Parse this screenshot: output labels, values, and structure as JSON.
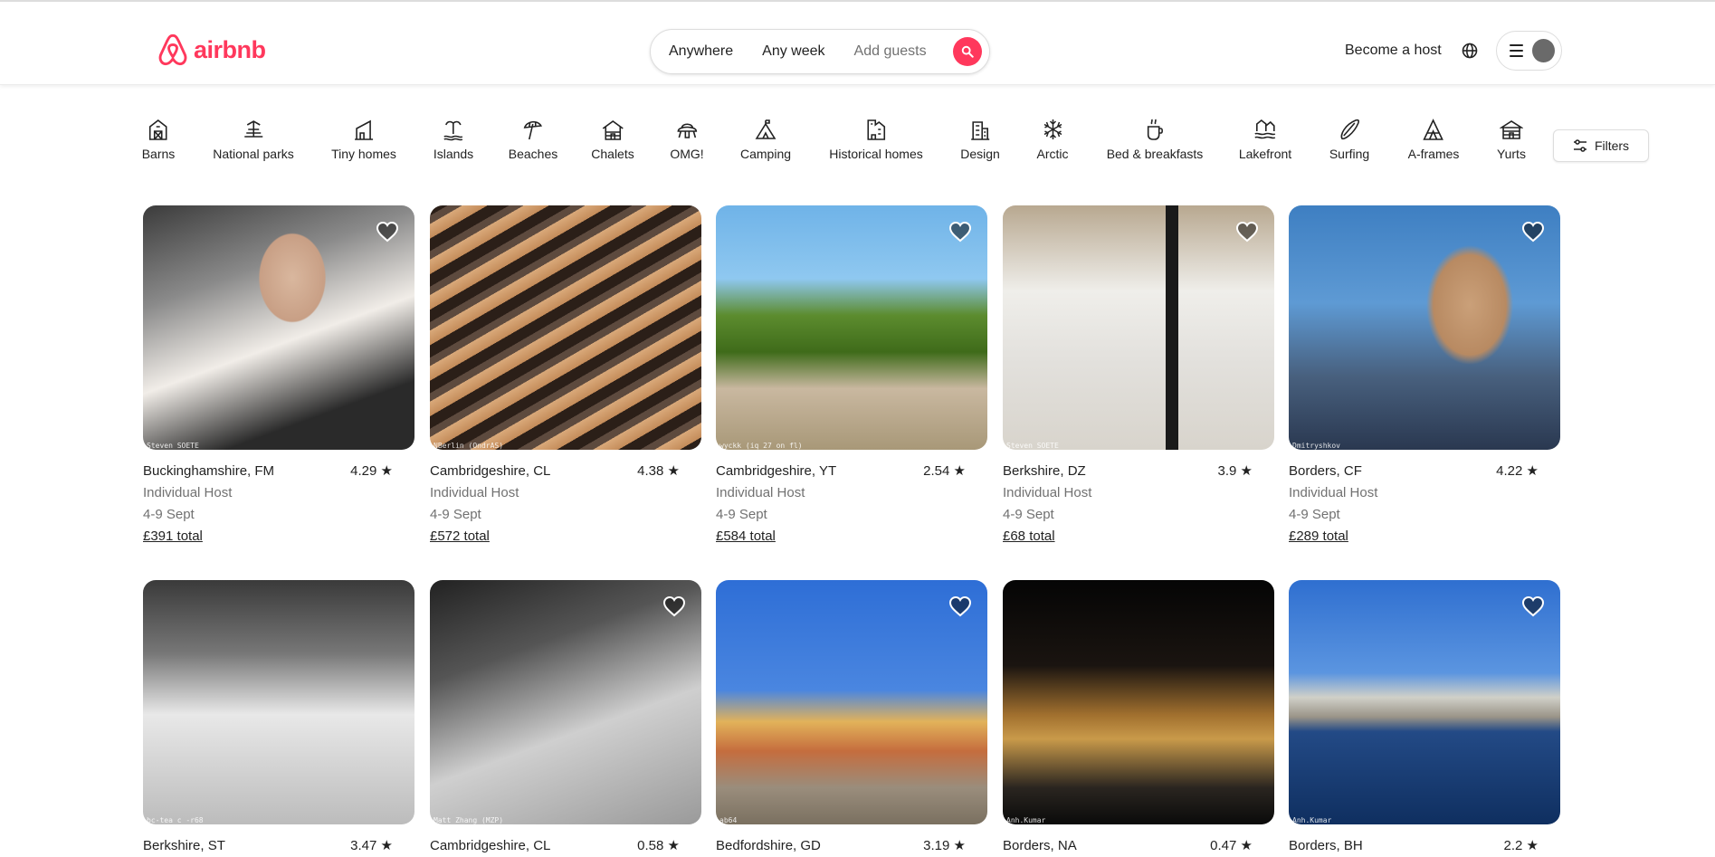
{
  "header": {
    "logo_text": "airbnb",
    "brand_color": "#ff385c",
    "search": {
      "anywhere": "Anywhere",
      "any_week": "Any week",
      "add_guests": "Add guests"
    },
    "become_host": "Become a host"
  },
  "categories": [
    {
      "label": "Barns",
      "icon": "barn-icon"
    },
    {
      "label": "National parks",
      "icon": "national-park-icon"
    },
    {
      "label": "Tiny homes",
      "icon": "tiny-home-icon"
    },
    {
      "label": "Islands",
      "icon": "island-icon"
    },
    {
      "label": "Beaches",
      "icon": "beach-umbrella-icon"
    },
    {
      "label": "Chalets",
      "icon": "chalet-icon"
    },
    {
      "label": "OMG!",
      "icon": "ufo-house-icon"
    },
    {
      "label": "Camping",
      "icon": "camping-icon"
    },
    {
      "label": "Historical homes",
      "icon": "historical-home-icon"
    },
    {
      "label": "Design",
      "icon": "design-building-icon"
    },
    {
      "label": "Arctic",
      "icon": "snowflake-icon"
    },
    {
      "label": "Bed & breakfasts",
      "icon": "coffee-cup-icon"
    },
    {
      "label": "Lakefront",
      "icon": "lakefront-icon"
    },
    {
      "label": "Surfing",
      "icon": "surfboard-icon"
    },
    {
      "label": "A-frames",
      "icon": "a-frame-icon"
    },
    {
      "label": "Yurts",
      "icon": "yurt-icon"
    }
  ],
  "filters_label": "Filters",
  "listings": [
    {
      "location": "Buckinghamshire, FM",
      "rating": "4.29",
      "host": "Individual Host",
      "dates": "4-9 Sept",
      "price": "£391 total",
      "credit": "Steven SOETE"
    },
    {
      "location": "Cambridgeshire, CL",
      "rating": "4.38",
      "host": "Individual Host",
      "dates": "4-9 Sept",
      "price": "£572 total",
      "credit": "NBerlin (OndrAS)"
    },
    {
      "location": "Cambridgeshire, YT",
      "rating": "2.54",
      "host": "Individual Host",
      "dates": "4-9 Sept",
      "price": "£584 total",
      "credit": "wyckk (iq 27 on fl)"
    },
    {
      "location": "Berkshire, DZ",
      "rating": "3.9",
      "host": "Individual Host",
      "dates": "4-9 Sept",
      "price": "£68 total",
      "credit": "Steven SOETE"
    },
    {
      "location": "Borders, CF",
      "rating": "4.22",
      "host": "Individual Host",
      "dates": "4-9 Sept",
      "price": "£289 total",
      "credit": "Dmitryshkov"
    },
    {
      "location": "Berkshire, ST",
      "rating": "3.47",
      "credit": "bc-tea c -r68"
    },
    {
      "location": "Cambridgeshire, CL",
      "rating": "0.58",
      "credit": "Matt Zhang (MZP)"
    },
    {
      "location": "Bedfordshire, GD",
      "rating": "3.19",
      "credit": "ab64"
    },
    {
      "location": "Borders, NA",
      "rating": "0.47",
      "credit": "Anh.Kumar"
    },
    {
      "location": "Borders, BH",
      "rating": "2.2",
      "credit": "Anh.Kumar"
    }
  ]
}
